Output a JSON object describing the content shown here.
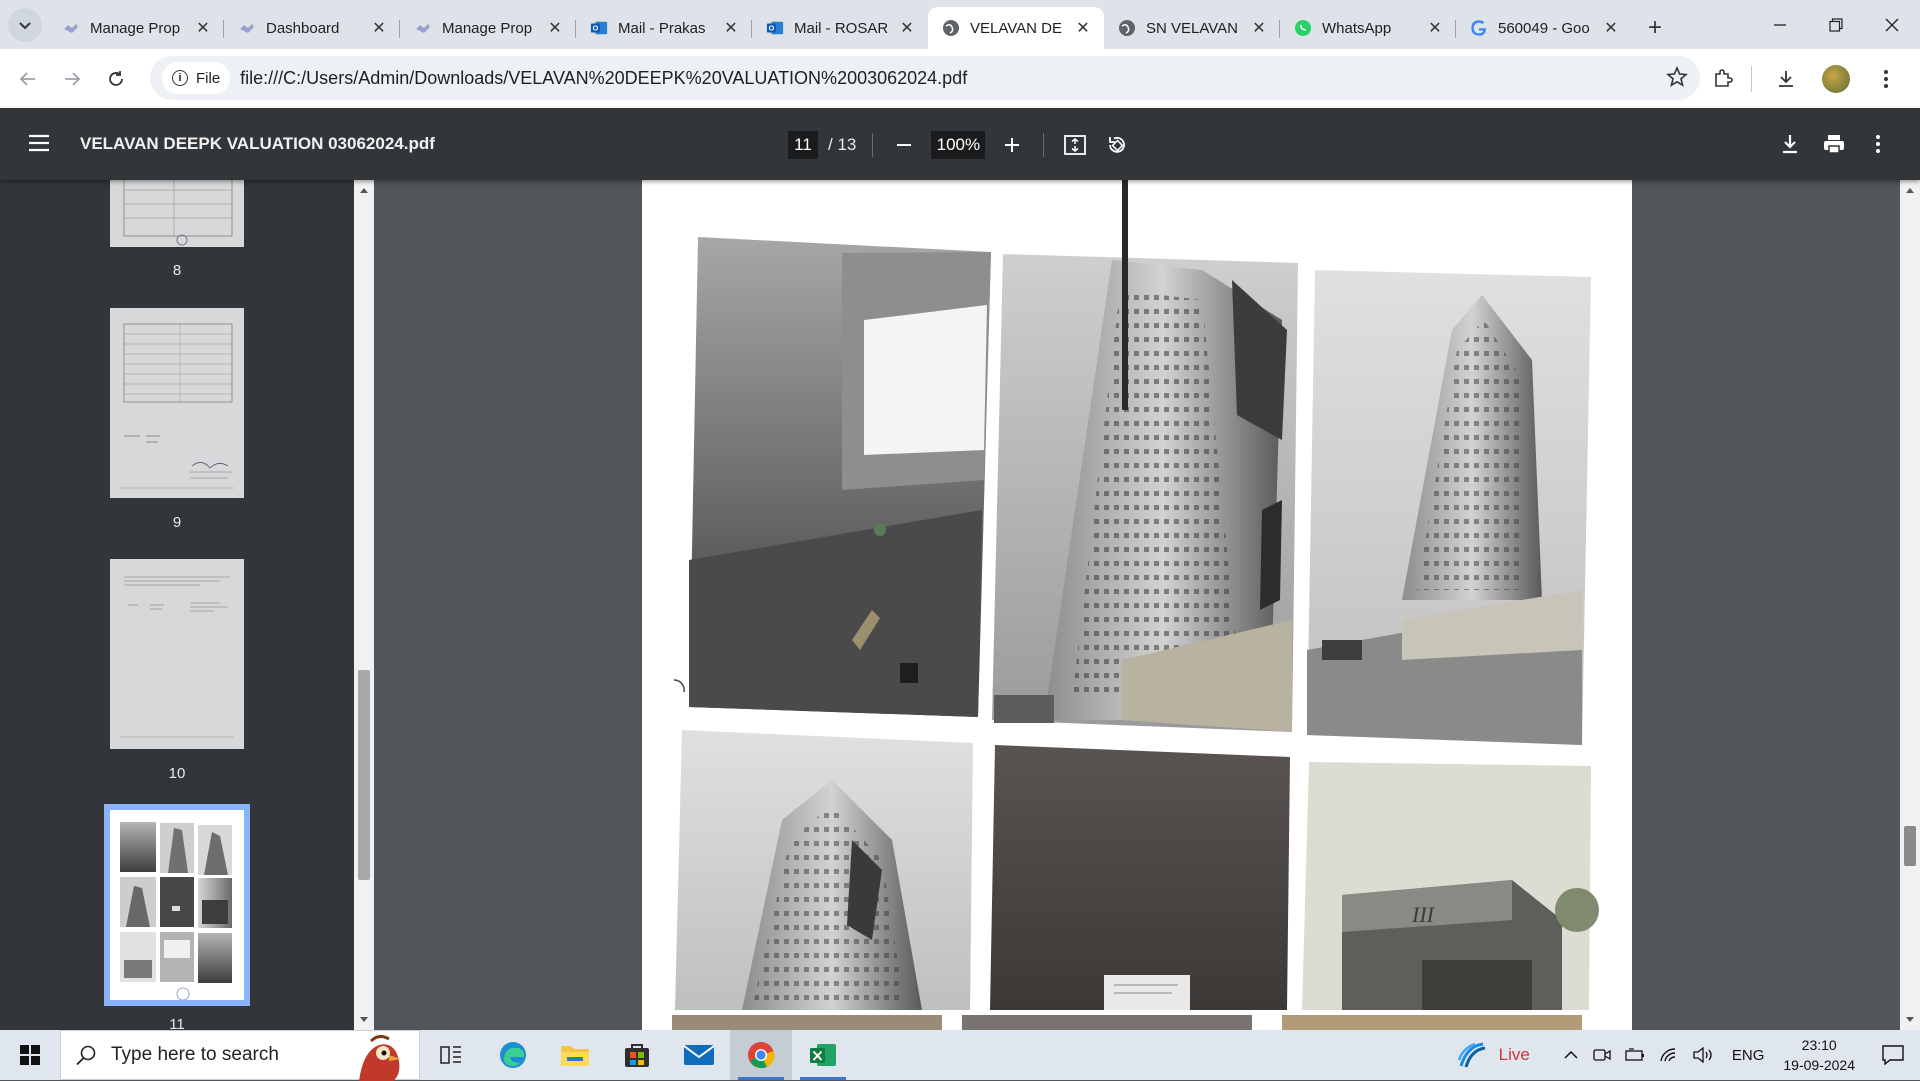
{
  "tabs": [
    {
      "label": "Manage Prop",
      "icon": "handshake-icon",
      "active": false
    },
    {
      "label": "Dashboard",
      "icon": "handshake-icon",
      "active": false
    },
    {
      "label": "Manage Prop",
      "icon": "handshake-icon",
      "active": false
    },
    {
      "label": "Mail - Prakas",
      "icon": "outlook-icon",
      "active": false
    },
    {
      "label": "Mail - ROSAR",
      "icon": "outlook-icon",
      "active": false
    },
    {
      "label": "VELAVAN DE",
      "icon": "globe-icon",
      "active": true
    },
    {
      "label": "SN VELAVAN",
      "icon": "globe-icon",
      "active": false
    },
    {
      "label": "WhatsApp",
      "icon": "whatsapp-icon",
      "active": false
    },
    {
      "label": "560049 - Goo",
      "icon": "google-icon",
      "active": false
    }
  ],
  "address": {
    "chip_label": "File",
    "url": "file:///C:/Users/Admin/Downloads/VELAVAN%20DEEPK%20VALUATION%2003062024.pdf"
  },
  "pdf": {
    "title": "VELAVAN DEEPK VALUATION 03062024.pdf",
    "current_page": "11",
    "total_pages": "/ 13",
    "zoom": "100%"
  },
  "thumbnails": [
    {
      "number": "8",
      "selected": false
    },
    {
      "number": "9",
      "selected": false
    },
    {
      "number": "10",
      "selected": false
    },
    {
      "number": "11",
      "selected": true
    }
  ],
  "taskbar": {
    "search_placeholder": "Type here to search",
    "weather_label": "Live",
    "language": "ENG",
    "time": "23:10",
    "date": "19-09-2024"
  },
  "colors": {
    "tabstrip": "#dee3ea",
    "pdf_toolbar": "#323639",
    "viewer_bg": "#525659",
    "selection_accent": "#8ab4f8",
    "live_red": "#d13438"
  }
}
